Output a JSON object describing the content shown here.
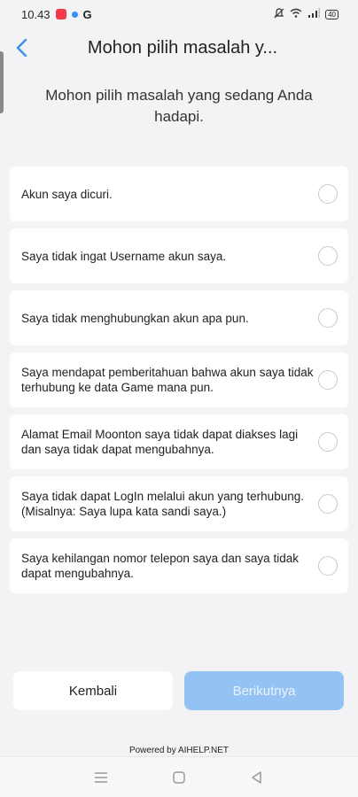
{
  "status_bar": {
    "time": "10.43",
    "app_letter": "G",
    "battery": "40"
  },
  "header": {
    "title": "Mohon pilih masalah y..."
  },
  "prompt": "Mohon pilih masalah yang sedang Anda hadapi.",
  "options": [
    {
      "label": "Akun saya dicuri."
    },
    {
      "label": "Saya tidak ingat Username akun saya."
    },
    {
      "label": "Saya tidak menghubungkan akun apa pun."
    },
    {
      "label": "Saya mendapat pemberitahuan bahwa akun saya tidak terhubung ke data Game mana pun."
    },
    {
      "label": "Alamat Email Moonton saya tidak dapat diakses lagi dan saya tidak dapat mengubahnya."
    },
    {
      "label": "Saya tidak dapat LogIn melalui akun yang terhubung. (Misalnya: Saya lupa kata sandi saya.)"
    },
    {
      "label": "Saya kehilangan nomor telepon saya dan saya tidak dapat mengubahnya."
    }
  ],
  "buttons": {
    "back_label": "Kembali",
    "next_label": "Berikutnya"
  },
  "footer": {
    "powered_by": "Powered by AIHELP.NET"
  },
  "colors": {
    "accent": "#3c8ef0",
    "next_button_disabled": "#94c3f3",
    "background": "#f3f3f5"
  },
  "icons": {
    "back": "chevron-left-icon",
    "nav_menu": "menu-icon",
    "nav_home": "home-icon",
    "nav_back": "triangle-back-icon"
  }
}
